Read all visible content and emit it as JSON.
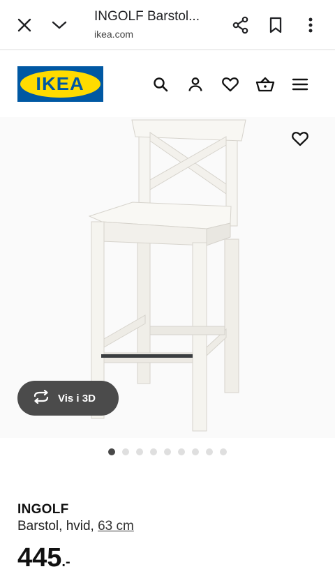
{
  "browser": {
    "title": "INGOLF Barstol...",
    "url": "ikea.com",
    "icons": [
      "close-icon",
      "chevron-down-icon",
      "share-icon",
      "bookmark-icon",
      "more-vert-icon"
    ]
  },
  "site": {
    "logo_text": "IKEA",
    "brand_colors": {
      "blue": "#0058a3",
      "yellow": "#ffdb00"
    },
    "header_icons": [
      "search-icon",
      "user-icon",
      "heart-icon",
      "basket-icon",
      "menu-icon"
    ]
  },
  "gallery": {
    "view_3d_label": "Vis i 3D",
    "dots_total": 9,
    "active_dot": 1
  },
  "product": {
    "name": "INGOLF",
    "description_prefix": "Barstol, hvid, ",
    "size_link": "63 cm",
    "price": "445",
    "price_suffix": ".-"
  }
}
